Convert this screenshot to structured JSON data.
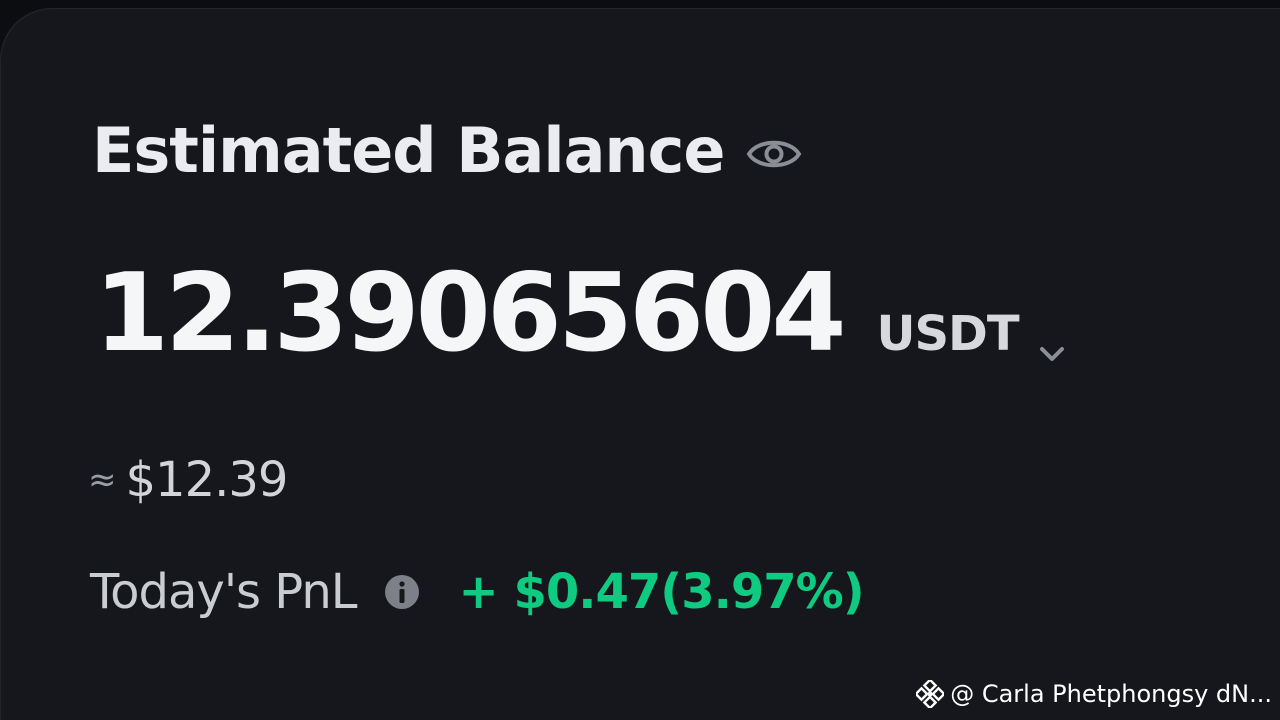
{
  "balance_card": {
    "title": "Estimated Balance",
    "amount": "12.39065604",
    "currency": "USDT",
    "approx_sign": "≈",
    "fiat_value": "$12.39",
    "pnl_label": "Today's PnL",
    "pnl_value": "+ $0.47(3.97%)"
  },
  "watermark": {
    "text": "@ Carla Phetphongsy dN..."
  },
  "icons": {
    "visibility": "eye-icon",
    "currency_dropdown": "chevron-down-icon",
    "pnl_info": "info-icon",
    "watermark_logo": "binance-logo-icon"
  },
  "colors": {
    "background": "#16171c",
    "text_primary": "#eaecef",
    "text_secondary": "#c9ccd1",
    "positive": "#0ecb81"
  }
}
